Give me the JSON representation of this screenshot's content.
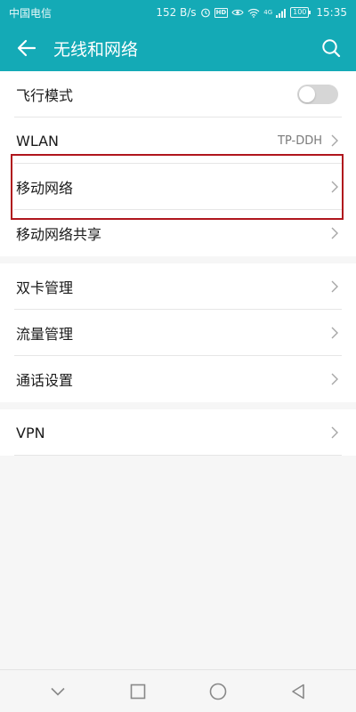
{
  "status_bar": {
    "carrier": "中国电信",
    "speed": "152 B/s",
    "hd_badge": "HD",
    "net_badge": "4G",
    "battery": "100",
    "time": "15:35",
    "icons": [
      "alarm-icon",
      "eye-icon",
      "wifi-icon",
      "signal-icon",
      "battery-icon"
    ]
  },
  "app_bar": {
    "title": "无线和网络",
    "back_icon": "back-arrow-icon",
    "search_icon": "search-icon",
    "background": "#14aab6"
  },
  "sections": [
    {
      "items": [
        {
          "label": "飞行模式",
          "control": "toggle",
          "on": false
        },
        {
          "label": "WLAN",
          "value": "TP-DDH"
        },
        {
          "label": "移动网络",
          "highlighted": true
        },
        {
          "label": "移动网络共享"
        }
      ]
    },
    {
      "items": [
        {
          "label": "双卡管理"
        },
        {
          "label": "流量管理"
        },
        {
          "label": "通话设置"
        }
      ]
    },
    {
      "items": [
        {
          "label": "VPN"
        }
      ]
    }
  ],
  "highlight_color": "#b0161d",
  "nav_bar": {
    "buttons": [
      "collapse-down-icon",
      "recents-square-icon",
      "home-circle-icon",
      "back-triangle-icon"
    ]
  }
}
